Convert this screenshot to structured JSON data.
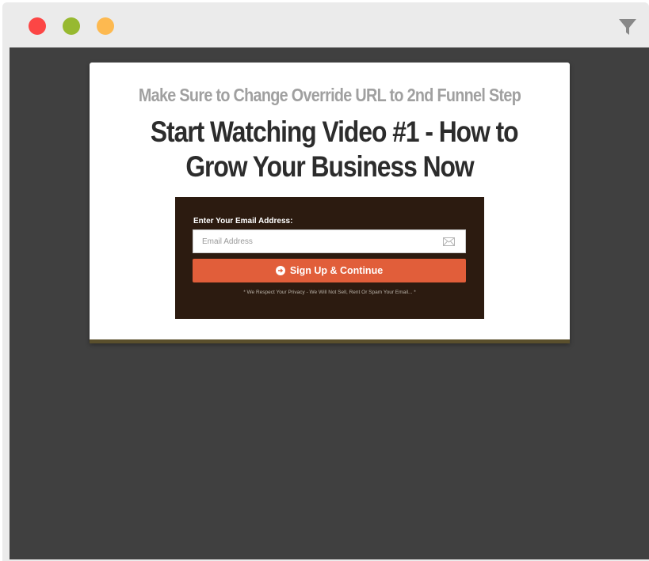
{
  "window": {
    "controls": [
      {
        "name": "close",
        "color": "#fc4645"
      },
      {
        "name": "minimize",
        "color": "#97b930"
      },
      {
        "name": "maximize",
        "color": "#fdb950"
      }
    ],
    "toolbar_icon": "filter-icon"
  },
  "colors": {
    "viewport_bg": "#404040",
    "subhead": "#a0a0a0",
    "headline": "#2c2c2c",
    "form_bg": "#2c1b10",
    "button_bg": "#e15e3a",
    "card_bottom_bar": "#5a4f2c"
  },
  "page": {
    "subheadline": "Make Sure to Change Override URL to 2nd Funnel Step",
    "headline_line1": "Start Watching Video #1 - How to",
    "headline_line2": "Grow Your Business Now"
  },
  "form": {
    "label": "Enter Your Email Address:",
    "email_placeholder": "Email Address",
    "email_value": "",
    "email_icon": "envelope-icon",
    "button_label": "Sign Up & Continue",
    "button_icon": "arrow-circle-right-icon",
    "privacy_text": "* We Respect Your Privacy - We Will Not Sell, Rent Or Spam Your Email... *"
  }
}
